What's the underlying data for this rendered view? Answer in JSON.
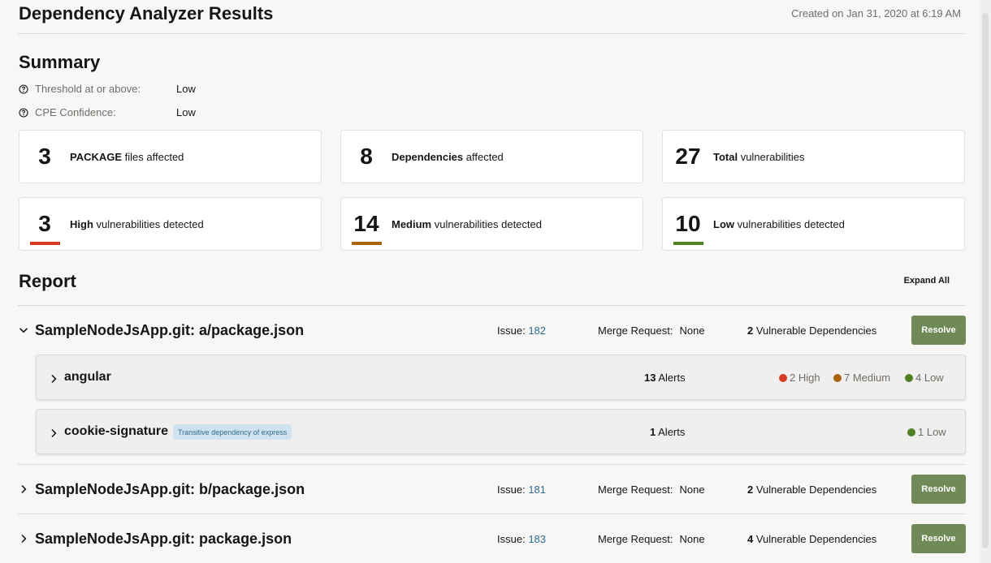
{
  "header": {
    "title": "Dependency Analyzer Results",
    "created": "Created on Jan 31, 2020 at 6:19 AM"
  },
  "summary": {
    "title": "Summary",
    "threshold_label": "Threshold at or above:",
    "threshold_value": "Low",
    "cpe_label": "CPE Confidence:",
    "cpe_value": "Low",
    "cards": [
      {
        "value": "3",
        "bold": "PACKAGE",
        "rest": " files affected"
      },
      {
        "value": "8",
        "bold": "Dependencies",
        "rest": " affected"
      },
      {
        "value": "27",
        "bold": "Total",
        "rest": " vulnerabilities"
      },
      {
        "value": "3",
        "bold": "High",
        "rest": " vulnerabilities detected",
        "color": "#d63b25"
      },
      {
        "value": "14",
        "bold": "Medium",
        "rest": " vulnerabilities detected",
        "color": "#ac630c"
      },
      {
        "value": "10",
        "bold": "Low",
        "rest": " vulnerabilities detected",
        "color": "#508223"
      }
    ]
  },
  "report": {
    "title": "Report",
    "expand_all": "Expand All",
    "issue_label": "Issue:",
    "merge_label": "Merge Request:",
    "resolve_label": "Resolve",
    "repos": [
      {
        "name": "SampleNodeJsApp.git: a/package.json",
        "issue": "182",
        "merge": "None",
        "vuln_count": "2",
        "vuln_text": " Vulnerable Dependencies",
        "expanded": true,
        "dependencies": [
          {
            "name": "angular",
            "tag": "",
            "alerts_count": "13",
            "alerts_text": " Alerts",
            "high": "2 High",
            "medium": "7 Medium",
            "low": "4 Low"
          },
          {
            "name": "cookie-signature",
            "tag": "Transitive dependency of express",
            "alerts_count": "1",
            "alerts_text": " Alerts",
            "low": "1 Low"
          }
        ]
      },
      {
        "name": "SampleNodeJsApp.git: b/package.json",
        "issue": "181",
        "merge": "None",
        "vuln_count": "2",
        "vuln_text": " Vulnerable Dependencies",
        "expanded": false
      },
      {
        "name": "SampleNodeJsApp.git: package.json",
        "issue": "183",
        "merge": "None",
        "vuln_count": "4",
        "vuln_text": " Vulnerable Dependencies",
        "expanded": false
      }
    ]
  },
  "colors": {
    "high": "#d63b25",
    "medium": "#ac630c",
    "low": "#508223",
    "resolve_button": "#6f8a57",
    "link": "#2e6b8f"
  },
  "icons": {
    "help": "help-circle-icon",
    "expanded": "chevron-down-icon",
    "collapsed": "chevron-right-icon"
  }
}
